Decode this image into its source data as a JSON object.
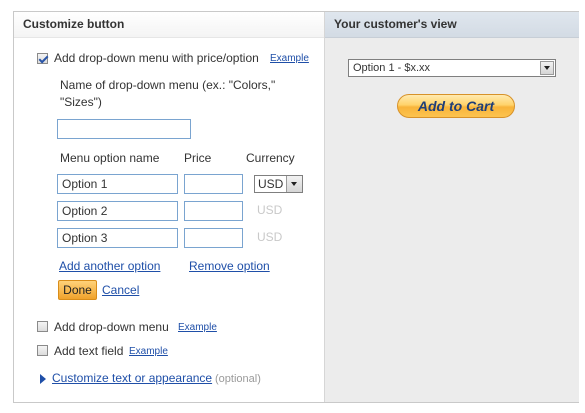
{
  "left_panel": {
    "title": "Customize button",
    "dropdown_price": {
      "checked": true,
      "label": "Add drop-down menu with price/option",
      "example": "Example"
    },
    "name_prompt_line1": "Name of drop-down menu (ex.: \"Colors,\"",
    "name_prompt_line2": "\"Sizes\")",
    "name_value": "",
    "headers": {
      "option": "Menu option name",
      "price": "Price",
      "currency": "Currency"
    },
    "options": [
      {
        "name": "Option 1",
        "price": "",
        "currency": "USD"
      },
      {
        "name": "Option 2",
        "price": "",
        "currency": "USD"
      },
      {
        "name": "Option 3",
        "price": "",
        "currency": "USD"
      }
    ],
    "add_option": "Add another option",
    "remove_option": "Remove option",
    "done": "Done",
    "cancel": "Cancel",
    "dropdown_plain": {
      "checked": false,
      "label": "Add drop-down menu",
      "example": "Example"
    },
    "text_field": {
      "checked": false,
      "label": "Add text field",
      "example": "Example"
    },
    "customize_link": "Customize text or appearance",
    "optional": "(optional)"
  },
  "right_panel": {
    "title": "Your customer's view",
    "select_value": "Option 1 - $x.xx",
    "cart_button": "Add to Cart"
  },
  "colors": {
    "link": "#1f4fa8",
    "done_button": "#f0a22c",
    "preview_header": "#d3dbe4",
    "preview_bg": "#ececec"
  }
}
